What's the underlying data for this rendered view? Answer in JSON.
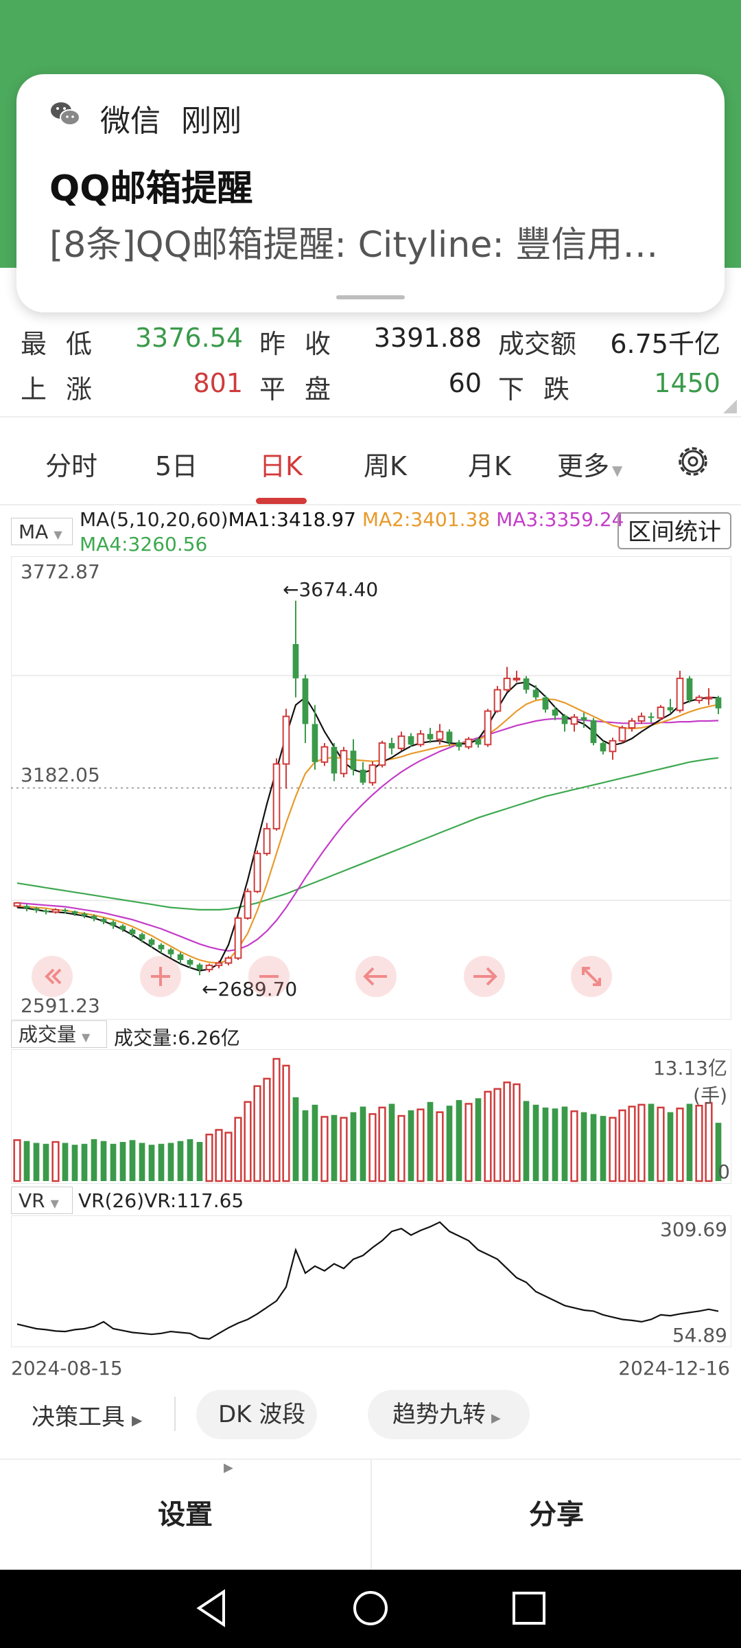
{
  "notification": {
    "app": "微信",
    "time": "刚刚",
    "title": "QQ邮箱提醒",
    "body": "[8条]QQ邮箱提醒: Cityline:   豐信用…"
  },
  "stats": {
    "low_label": "最低",
    "low_value": "3376.54",
    "prev_close_label": "昨收",
    "prev_close_value": "3391.88",
    "turnover_label": "成交额",
    "turnover_value": "6.75千亿",
    "up_label": "上涨",
    "up_value": "801",
    "flat_label": "平盘",
    "flat_value": "60",
    "down_label": "下跌",
    "down_value": "1450"
  },
  "tabs": [
    "分时",
    "5日",
    "日K",
    "周K",
    "月K",
    "更多"
  ],
  "active_tab": "日K",
  "ma": {
    "selector": "MA",
    "params": "MA(5,10,20,60)",
    "ma1": "MA1:3418.97",
    "ma2": "MA2:3401.38",
    "ma3": "MA3:3359.24",
    "ma4": "MA4:3260.56",
    "range_button": "区间统计",
    "colors": {
      "ma1": "#111111",
      "ma2": "#e89a2a",
      "ma3": "#c43cc8",
      "ma4": "#3da84f"
    }
  },
  "kline_axis": {
    "top": "3772.87",
    "mid": "3182.05",
    "bottom": "2591.23",
    "high_marker": "←3674.40",
    "low_marker": "←2689.70"
  },
  "volume": {
    "selector": "成交量",
    "value_label": "成交量:6.26亿",
    "max_label": "13.13亿(手)",
    "zero_label": "0"
  },
  "vr": {
    "selector": "VR",
    "value_label": "VR(26)VR:117.65",
    "max_label": "309.69",
    "min_label": "54.89"
  },
  "dates": {
    "start": "2024-08-15",
    "end": "2024-12-16"
  },
  "tools": {
    "decision": "决策工具",
    "dk": "DK 波段",
    "trend": "趋势九转"
  },
  "bottom": {
    "settings": "设置",
    "share": "分享"
  },
  "colors": {
    "up": "#cf3b3b",
    "down": "#3a9a4a",
    "header": "#4caa5c"
  },
  "chart_data": {
    "type": "candlestick",
    "price_axis": {
      "max": 3772.87,
      "min": 2591.23
    },
    "candles": [
      [
        2872,
        2880,
        2868,
        2882
      ],
      [
        2872,
        2866,
        2858,
        2876
      ],
      [
        2866,
        2860,
        2854,
        2870
      ],
      [
        2860,
        2856,
        2850,
        2864
      ],
      [
        2856,
        2862,
        2852,
        2866
      ],
      [
        2862,
        2858,
        2852,
        2866
      ],
      [
        2858,
        2852,
        2846,
        2860
      ],
      [
        2852,
        2846,
        2840,
        2856
      ],
      [
        2846,
        2838,
        2832,
        2850
      ],
      [
        2838,
        2830,
        2824,
        2842
      ],
      [
        2830,
        2820,
        2812,
        2834
      ],
      [
        2820,
        2810,
        2804,
        2824
      ],
      [
        2810,
        2798,
        2790,
        2814
      ],
      [
        2798,
        2784,
        2776,
        2802
      ],
      [
        2784,
        2770,
        2762,
        2788
      ],
      [
        2770,
        2758,
        2748,
        2774
      ],
      [
        2758,
        2745,
        2736,
        2762
      ],
      [
        2745,
        2730,
        2720,
        2750
      ],
      [
        2730,
        2718,
        2708,
        2734
      ],
      [
        2718,
        2705,
        2690,
        2722
      ],
      [
        2705,
        2716,
        2698,
        2720
      ],
      [
        2716,
        2722,
        2708,
        2728
      ],
      [
        2722,
        2735,
        2716,
        2740
      ],
      [
        2735,
        2840,
        2730,
        2845
      ],
      [
        2840,
        2910,
        2836,
        2918
      ],
      [
        2910,
        3010,
        2906,
        3018
      ],
      [
        3010,
        3075,
        3004,
        3090
      ],
      [
        3075,
        3245,
        3070,
        3260
      ],
      [
        3245,
        3370,
        3180,
        3390
      ],
      [
        3560,
        3470,
        3420,
        3674
      ],
      [
        3470,
        3350,
        3300,
        3480
      ],
      [
        3350,
        3250,
        3230,
        3400
      ],
      [
        3250,
        3290,
        3240,
        3300
      ],
      [
        3290,
        3220,
        3200,
        3300
      ],
      [
        3220,
        3280,
        3210,
        3290
      ],
      [
        3280,
        3230,
        3215,
        3310
      ],
      [
        3230,
        3196,
        3190,
        3250
      ],
      [
        3196,
        3242,
        3188,
        3252
      ],
      [
        3242,
        3300,
        3236,
        3306
      ],
      [
        3300,
        3286,
        3270,
        3314
      ],
      [
        3286,
        3318,
        3280,
        3330
      ],
      [
        3318,
        3296,
        3290,
        3326
      ],
      [
        3296,
        3324,
        3290,
        3334
      ],
      [
        3324,
        3310,
        3300,
        3340
      ],
      [
        3310,
        3330,
        3296,
        3350
      ],
      [
        3330,
        3302,
        3292,
        3336
      ],
      [
        3302,
        3290,
        3280,
        3308
      ],
      [
        3290,
        3310,
        3284,
        3316
      ],
      [
        3310,
        3296,
        3288,
        3314
      ],
      [
        3296,
        3384,
        3290,
        3390
      ],
      [
        3384,
        3440,
        3380,
        3450
      ],
      [
        3440,
        3470,
        3434,
        3500
      ],
      [
        3470,
        3470,
        3460,
        3490
      ],
      [
        3470,
        3440,
        3430,
        3476
      ],
      [
        3440,
        3420,
        3414,
        3452
      ],
      [
        3420,
        3388,
        3380,
        3426
      ],
      [
        3388,
        3372,
        3360,
        3396
      ],
      [
        3372,
        3350,
        3330,
        3376
      ],
      [
        3350,
        3368,
        3330,
        3376
      ],
      [
        3368,
        3360,
        3340,
        3380
      ],
      [
        3360,
        3300,
        3294,
        3366
      ],
      [
        3300,
        3278,
        3270,
        3306
      ],
      [
        3278,
        3306,
        3256,
        3314
      ],
      [
        3306,
        3340,
        3300,
        3346
      ],
      [
        3340,
        3358,
        3330,
        3366
      ],
      [
        3358,
        3370,
        3350,
        3380
      ],
      [
        3370,
        3366,
        3354,
        3380
      ],
      [
        3366,
        3394,
        3360,
        3400
      ],
      [
        3394,
        3386,
        3380,
        3416
      ],
      [
        3386,
        3470,
        3380,
        3490
      ],
      [
        3470,
        3412,
        3406,
        3476
      ],
      [
        3412,
        3420,
        3404,
        3426
      ],
      [
        3420,
        3420,
        3400,
        3444
      ],
      [
        3420,
        3391,
        3376,
        3424
      ]
    ],
    "ma1": [
      2868,
      2866,
      2862,
      2858,
      2856,
      2854,
      2850,
      2846,
      2840,
      2832,
      2822,
      2810,
      2796,
      2780,
      2764,
      2748,
      2734,
      2720,
      2710,
      2702,
      2706,
      2720,
      2770,
      2850,
      2940,
      3040,
      3140,
      3230,
      3320,
      3400,
      3420,
      3380,
      3330,
      3290,
      3250,
      3230,
      3222,
      3230,
      3250,
      3262,
      3278,
      3292,
      3300,
      3304,
      3306,
      3300,
      3298,
      3298,
      3310,
      3346,
      3390,
      3432,
      3456,
      3460,
      3446,
      3422,
      3394,
      3370,
      3360,
      3350,
      3330,
      3306,
      3294,
      3300,
      3312,
      3330,
      3346,
      3362,
      3376,
      3400,
      3410,
      3416,
      3420,
      3419
    ],
    "ma2": [
      2872,
      2870,
      2868,
      2866,
      2862,
      2860,
      2856,
      2852,
      2848,
      2842,
      2836,
      2828,
      2818,
      2806,
      2794,
      2780,
      2766,
      2752,
      2740,
      2730,
      2724,
      2722,
      2730,
      2760,
      2800,
      2860,
      2930,
      3010,
      3090,
      3160,
      3220,
      3250,
      3260,
      3262,
      3260,
      3256,
      3254,
      3252,
      3254,
      3258,
      3264,
      3272,
      3278,
      3284,
      3290,
      3294,
      3298,
      3302,
      3308,
      3322,
      3340,
      3362,
      3384,
      3402,
      3412,
      3416,
      3414,
      3406,
      3394,
      3382,
      3370,
      3358,
      3346,
      3340,
      3338,
      3340,
      3346,
      3354,
      3362,
      3372,
      3382,
      3390,
      3396,
      3401
    ],
    "ma3": [
      2880,
      2878,
      2876,
      2874,
      2872,
      2870,
      2866,
      2862,
      2858,
      2854,
      2848,
      2842,
      2836,
      2828,
      2820,
      2812,
      2802,
      2792,
      2782,
      2772,
      2764,
      2758,
      2754,
      2758,
      2768,
      2784,
      2806,
      2834,
      2868,
      2906,
      2946,
      2984,
      3020,
      3054,
      3086,
      3114,
      3140,
      3164,
      3186,
      3206,
      3224,
      3240,
      3254,
      3266,
      3278,
      3288,
      3298,
      3306,
      3314,
      3322,
      3330,
      3338,
      3346,
      3352,
      3358,
      3362,
      3364,
      3364,
      3362,
      3360,
      3358,
      3356,
      3354,
      3352,
      3352,
      3352,
      3352,
      3354,
      3354,
      3356,
      3356,
      3358,
      3358,
      3359
    ],
    "ma4": [
      2932,
      2928,
      2924,
      2920,
      2916,
      2912,
      2908,
      2904,
      2900,
      2896,
      2892,
      2888,
      2884,
      2880,
      2876,
      2872,
      2868,
      2866,
      2864,
      2862,
      2862,
      2862,
      2864,
      2868,
      2874,
      2880,
      2888,
      2896,
      2904,
      2914,
      2924,
      2934,
      2944,
      2954,
      2964,
      2974,
      2984,
      2994,
      3004,
      3014,
      3024,
      3034,
      3044,
      3054,
      3064,
      3074,
      3084,
      3094,
      3104,
      3112,
      3120,
      3128,
      3136,
      3144,
      3152,
      3160,
      3166,
      3172,
      3178,
      3184,
      3190,
      3196,
      3202,
      3208,
      3214,
      3220,
      3226,
      3232,
      3238,
      3244,
      3250,
      3254,
      3258,
      3261
    ],
    "volume_unit": "亿(手)",
    "volume_max": 13.13,
    "volume": [
      4.4,
      4.3,
      4.1,
      4.0,
      4.2,
      4.1,
      3.9,
      4.0,
      4.5,
      4.3,
      4.0,
      4.2,
      4.4,
      4.1,
      3.9,
      4.0,
      4.1,
      4.3,
      4.5,
      4.2,
      5.0,
      5.5,
      5.2,
      6.8,
      8.5,
      10.2,
      11.0,
      13.13,
      12.4,
      9.0,
      7.6,
      8.2,
      6.9,
      7.1,
      6.8,
      7.4,
      8.0,
      7.2,
      7.9,
      8.3,
      7.0,
      7.6,
      7.7,
      8.5,
      7.4,
      8.1,
      8.7,
      8.3,
      8.9,
      9.6,
      9.9,
      10.6,
      10.4,
      8.6,
      8.2,
      7.9,
      7.8,
      8.0,
      7.5,
      7.4,
      7.2,
      7.0,
      6.8,
      7.6,
      8.0,
      8.2,
      8.3,
      7.9,
      7.4,
      7.8,
      8.3,
      8.1,
      8.4,
      6.26
    ],
    "vr_range": [
      54.89,
      309.69
    ],
    "vr": [
      90,
      85,
      80,
      78,
      75,
      74,
      78,
      80,
      85,
      95,
      80,
      76,
      72,
      70,
      68,
      70,
      74,
      72,
      70,
      60,
      58,
      70,
      82,
      92,
      100,
      112,
      126,
      140,
      170,
      250,
      200,
      215,
      205,
      220,
      210,
      230,
      238,
      255,
      270,
      290,
      296,
      282,
      292,
      300,
      310,
      290,
      280,
      270,
      250,
      240,
      230,
      210,
      190,
      180,
      160,
      150,
      140,
      130,
      125,
      120,
      118,
      110,
      105,
      100,
      98,
      95,
      100,
      110,
      108,
      112,
      115,
      118,
      122,
      117.65
    ]
  }
}
